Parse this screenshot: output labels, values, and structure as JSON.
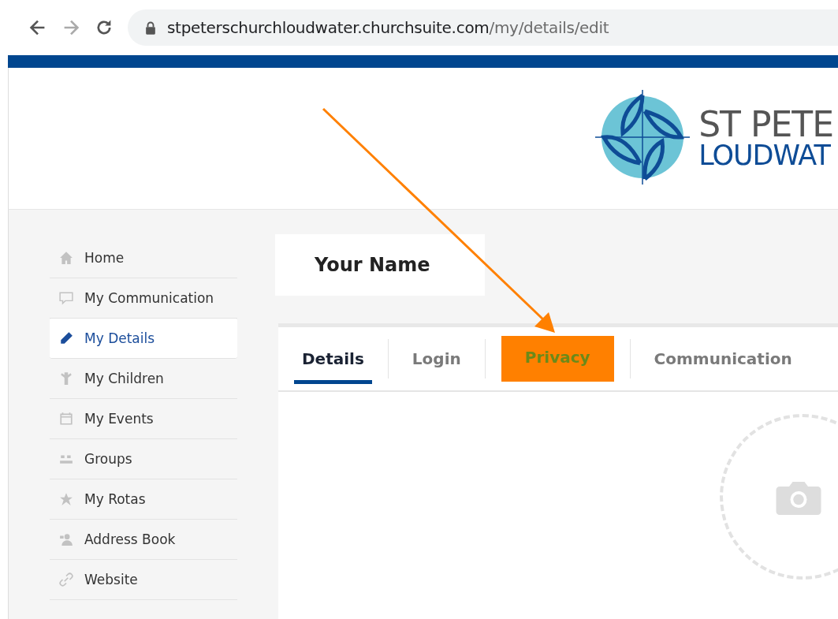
{
  "browser": {
    "url_host": "stpeterschurchloudwater.churchsuite.com",
    "url_path": "/my/details/edit"
  },
  "logo": {
    "line_1": "ST PETE",
    "line_2": "LOUDWAT"
  },
  "sidebar": {
    "items": [
      {
        "label": "Home",
        "selected": false
      },
      {
        "label": "My Communication",
        "selected": false
      },
      {
        "label": "My Details",
        "selected": true
      },
      {
        "label": "My Children",
        "selected": false
      },
      {
        "label": "My Events",
        "selected": false
      },
      {
        "label": "Groups",
        "selected": false
      },
      {
        "label": "My Rotas",
        "selected": false
      },
      {
        "label": "Address Book",
        "selected": false
      },
      {
        "label": "Website",
        "selected": false
      }
    ]
  },
  "profile": {
    "name": "Your Name"
  },
  "tabs": [
    {
      "label": "Details",
      "selected": true,
      "highlighted": false
    },
    {
      "label": "Login",
      "selected": false,
      "highlighted": false
    },
    {
      "label": "Privacy",
      "selected": false,
      "highlighted": true
    },
    {
      "label": "Communication",
      "selected": false,
      "highlighted": false
    }
  ]
}
